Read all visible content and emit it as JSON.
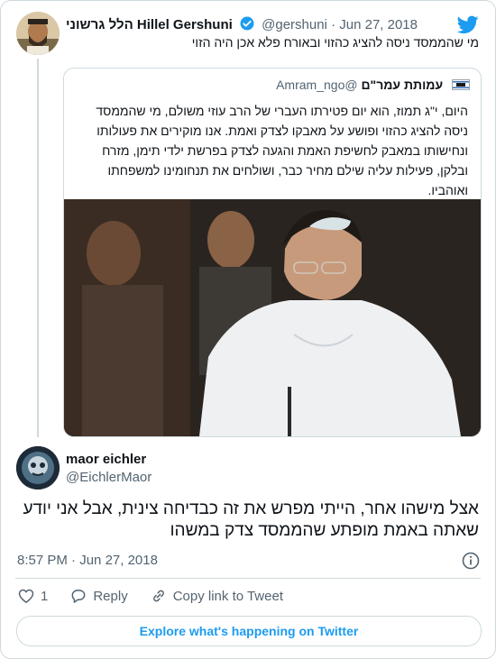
{
  "parent_tweet": {
    "name": "הלל גרשוני Hillel Gershuni",
    "handle": "@gershuni",
    "separator": "·",
    "date": "Jun 27, 2018",
    "text": "מי שהממסד ניסה להציג כהזוי ובאורח פלא אכן היה הזוי"
  },
  "quoted_tweet": {
    "name": "עמותת עמר\"ם",
    "handle": "@Amram_ngo",
    "text": "היום, י\"ג תמוז, הוא יום פטירתו העברי של הרב עוזי משולם, מי שהממסד ניסה להציג כהזוי ופושע על מאבקו לצדק ואמת. אנו מוקירים את פעולותו ונחישותו במאבק לחשיפת האמת והגעה לצדק בפרשת ילדי תימן, מזרח ובלקן, פעילות עליה שילם מחיר כבר, ושולחים את תנחומינו למשפחתו ואוהביו."
  },
  "reply_tweet": {
    "name": "maor eichler",
    "handle": "@EichlerMaor",
    "text": "אצל מישהו אחר, הייתי מפרש את זה כבדיחה צינית, אבל אני יודע שאתה באמת מופתע שהממסד צדק במשהו",
    "time": "8:57 PM",
    "separator": "·",
    "date": "Jun 27, 2018"
  },
  "actions": {
    "like_count": "1",
    "reply_label": "Reply",
    "copy_link_label": "Copy link to Tweet"
  },
  "explore_label": "Explore what's happening on Twitter",
  "colors": {
    "brand": "#1d9bf0",
    "like": "#536471",
    "border": "#cfd9de"
  },
  "icons": [
    "twitter-bird-icon",
    "verified-badge-icon",
    "flag-icon",
    "info-icon",
    "heart-icon",
    "reply-icon",
    "link-icon"
  ]
}
